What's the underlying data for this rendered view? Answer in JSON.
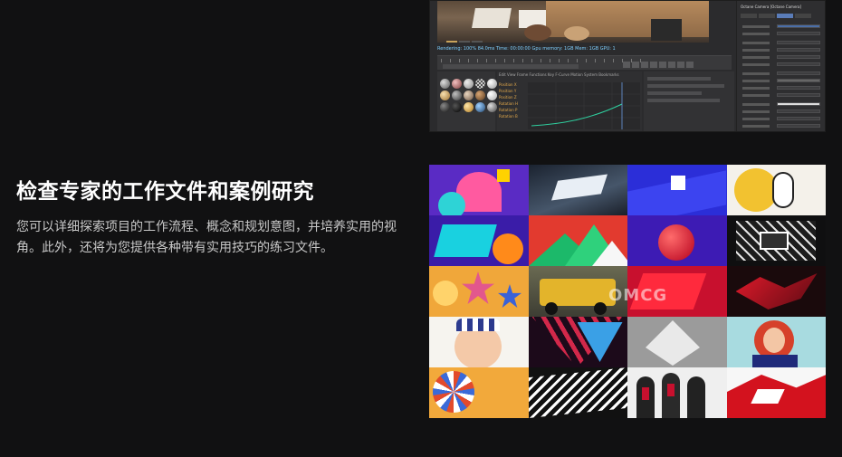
{
  "section": {
    "heading": "检查专家的工作文件和案例研究",
    "description": "您可以详细探索项目的工作流程、概念和规划意图，并培养实用的视角。此外，还将为您提供各种带有实用技巧的练习文件。"
  },
  "software_preview": {
    "status_text": "Rendering: 100% 84.0ms  Time: 00:00:00  Gpu memory: 1GB  Mem: 1GB  GPU: 1",
    "graph_menu": "Edit  View  Frame  Functions  Key  F-Curve  Motion System  Bookmarks",
    "layers": [
      "Position X",
      "Position Y",
      "Position Z",
      "Rotation H",
      "Rotation P",
      "Rotation B"
    ],
    "attributes_title": "Octane Camera [Octane Camera]"
  },
  "gallery": {
    "watermark": "OMCG",
    "tile_count": 20
  },
  "colors": {
    "background": "#111112",
    "heading": "#ffffff",
    "description": "#c8c8c8"
  }
}
